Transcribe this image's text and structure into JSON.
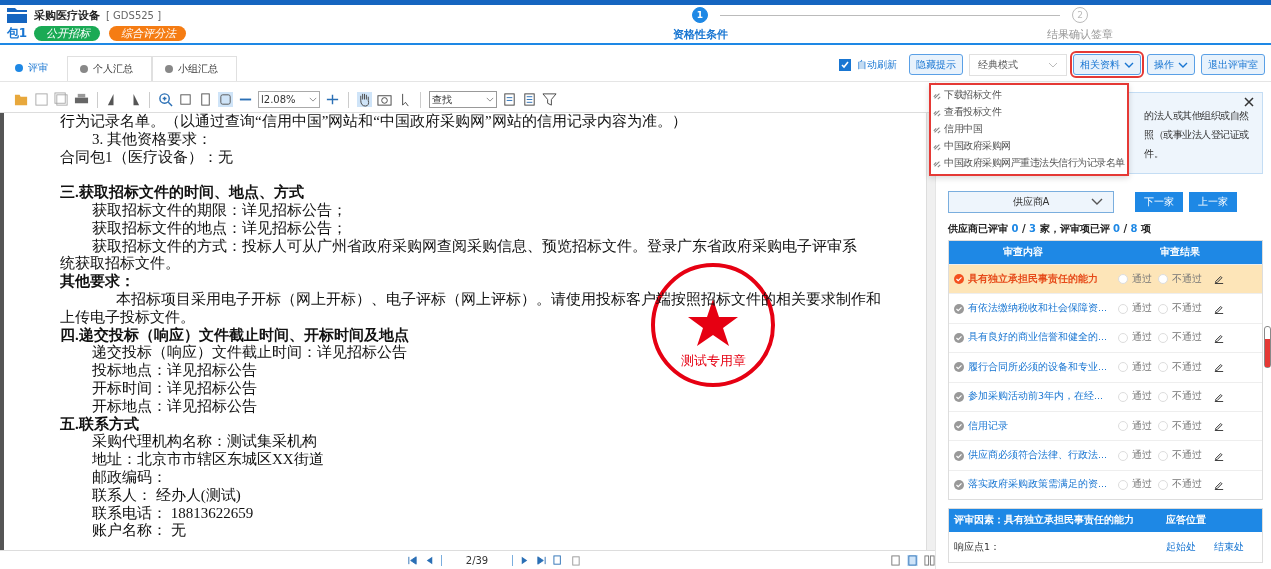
{
  "project": {
    "package": "包1",
    "title": "采购医疗设备",
    "code": "[ GDS525 ]",
    "tags": [
      {
        "label": "公开招标",
        "color": "#1aaa55"
      },
      {
        "label": "综合评分法",
        "color": "#f57c13"
      }
    ]
  },
  "steps": [
    {
      "number": "1",
      "label": "资格性条件",
      "selected": true
    },
    {
      "number": "2",
      "label": "结果确认签章",
      "selected": false
    }
  ],
  "tabs": [
    {
      "label": "评审",
      "selected": true
    },
    {
      "label": "个人汇总",
      "selected": false
    },
    {
      "label": "小组汇总",
      "selected": false
    }
  ],
  "controls": {
    "auto_refresh": {
      "label": "自动刷新",
      "checked": true
    },
    "hide_tips": "隐藏提示",
    "mode": "经典模式",
    "buttons": [
      {
        "label": "相关资料",
        "highlighted": true
      },
      {
        "label": "操作",
        "highlighted": false
      }
    ],
    "exit": "退出评审室"
  },
  "toolbar": {
    "zoom": "l2.08%",
    "search": "查找"
  },
  "document": {
    "lines": [
      {
        "kind": "text",
        "text": "行为记录名单。（以通过查询“信用中国”网站和“中国政府采购网”网站的信用记录内容为准。）"
      },
      {
        "kind": "indented",
        "text": "3. 其他资格要求："
      },
      {
        "kind": "text",
        "text": "合同包1（医疗设备）：无"
      },
      {
        "kind": "blank"
      },
      {
        "kind": "heading",
        "text": "三.获取招标文件的时间、地点、方式"
      },
      {
        "kind": "indented",
        "text": "获取招标文件的期限：详见招标公告；"
      },
      {
        "kind": "indented",
        "text": "获取招标文件的地点：详见招标公告；"
      },
      {
        "kind": "indented",
        "text": "获取招标文件的方式：投标人可从广州省政府采购网查阅采购信息、预览招标文件。登录广东省政府采购电子评审系"
      },
      {
        "kind": "text",
        "text": "统获取招标文件。"
      },
      {
        "kind": "heading",
        "text": "其他要求："
      },
      {
        "kind": "para",
        "text": "本招标项目采用电子开标（网上开标）、电子评标（网上评标）。请使用投标客户端按照招标文件的相关要求制作和"
      },
      {
        "kind": "text",
        "text": "上传电子投标文件。"
      },
      {
        "kind": "heading",
        "text": "四.递交投标（响应）文件截止时间、开标时间及地点"
      },
      {
        "kind": "indented",
        "text": "递交投标（响应）文件截止时间：详见招标公告"
      },
      {
        "kind": "indented",
        "text": "投标地点：详见招标公告"
      },
      {
        "kind": "indented",
        "text": "开标时间：详见招标公告"
      },
      {
        "kind": "indented",
        "text": "开标地点：详见招标公告"
      },
      {
        "kind": "heading",
        "text": "五.联系方式"
      },
      {
        "kind": "indented",
        "text": "采购代理机构名称：测试集采机构"
      },
      {
        "kind": "indented",
        "text": "地址：北京市市辖区东城区XX街道"
      },
      {
        "kind": "indented",
        "text": "邮政编码："
      },
      {
        "kind": "indented",
        "text": "联系人： 经办人(测试)"
      },
      {
        "kind": "indented",
        "text": "联系电话： 18813622659"
      },
      {
        "kind": "indented",
        "text": "账户名称： 无"
      }
    ],
    "seal": {
      "text": "测试专用章"
    }
  },
  "pager": {
    "page": "2/39"
  },
  "resource_menu": [
    {
      "label": "下载招标文件"
    },
    {
      "label": "查看投标文件"
    },
    {
      "label": "信用中国"
    },
    {
      "label": "中国政府采购网"
    },
    {
      "label": "中国政府采购网严重违法失信行为记录名单"
    }
  ],
  "notice": {
    "lines": [
      "的法人或其他组织或自然",
      "照（或事业法人登记证或",
      "件。"
    ]
  },
  "supplier": {
    "value": "供应商A",
    "next": "下一家",
    "prev": "上一家"
  },
  "progress": [
    {
      "kind": "text",
      "text": "供应商已评审 "
    },
    {
      "kind": "num",
      "text": "0"
    },
    {
      "kind": "text",
      "text": " / "
    },
    {
      "kind": "num",
      "text": "3"
    },
    {
      "kind": "text",
      "text": " 家，评审项已评 "
    },
    {
      "kind": "num",
      "text": "0"
    },
    {
      "kind": "text",
      "text": " / "
    },
    {
      "kind": "num",
      "text": "8"
    },
    {
      "kind": "text",
      "text": " 项"
    }
  ],
  "review": {
    "columns": [
      "审查内容",
      "审查结果"
    ],
    "rows": [
      {
        "item": "具有独立承担民事责任的能力",
        "pass": "通过",
        "fail": "不通过",
        "selected": true
      },
      {
        "item": "有依法缴纳税收和社会保障资...",
        "pass": "通过",
        "fail": "不通过",
        "selected": false
      },
      {
        "item": "具有良好的商业信誉和健全的...",
        "pass": "通过",
        "fail": "不通过",
        "selected": false
      },
      {
        "item": "履行合同所必须的设备和专业...",
        "pass": "通过",
        "fail": "不通过",
        "selected": false
      },
      {
        "item": "参加采购活动前3年内，在经...",
        "pass": "通过",
        "fail": "不通过",
        "selected": false
      },
      {
        "item": "信用记录",
        "pass": "通过",
        "fail": "不通过",
        "selected": false
      },
      {
        "item": "供应商必须符合法律、行政法...",
        "pass": "通过",
        "fail": "不通过",
        "selected": false
      },
      {
        "item": "落实政府采购政策需满足的资...",
        "pass": "通过",
        "fail": "不通过",
        "selected": false
      }
    ]
  },
  "factor": {
    "columns": [
      "评审因素：具有独立承担民事责任的能力",
      "应答位置"
    ],
    "row": {
      "label": "响应点1：",
      "start": "起始处",
      "end": "结束处"
    }
  }
}
